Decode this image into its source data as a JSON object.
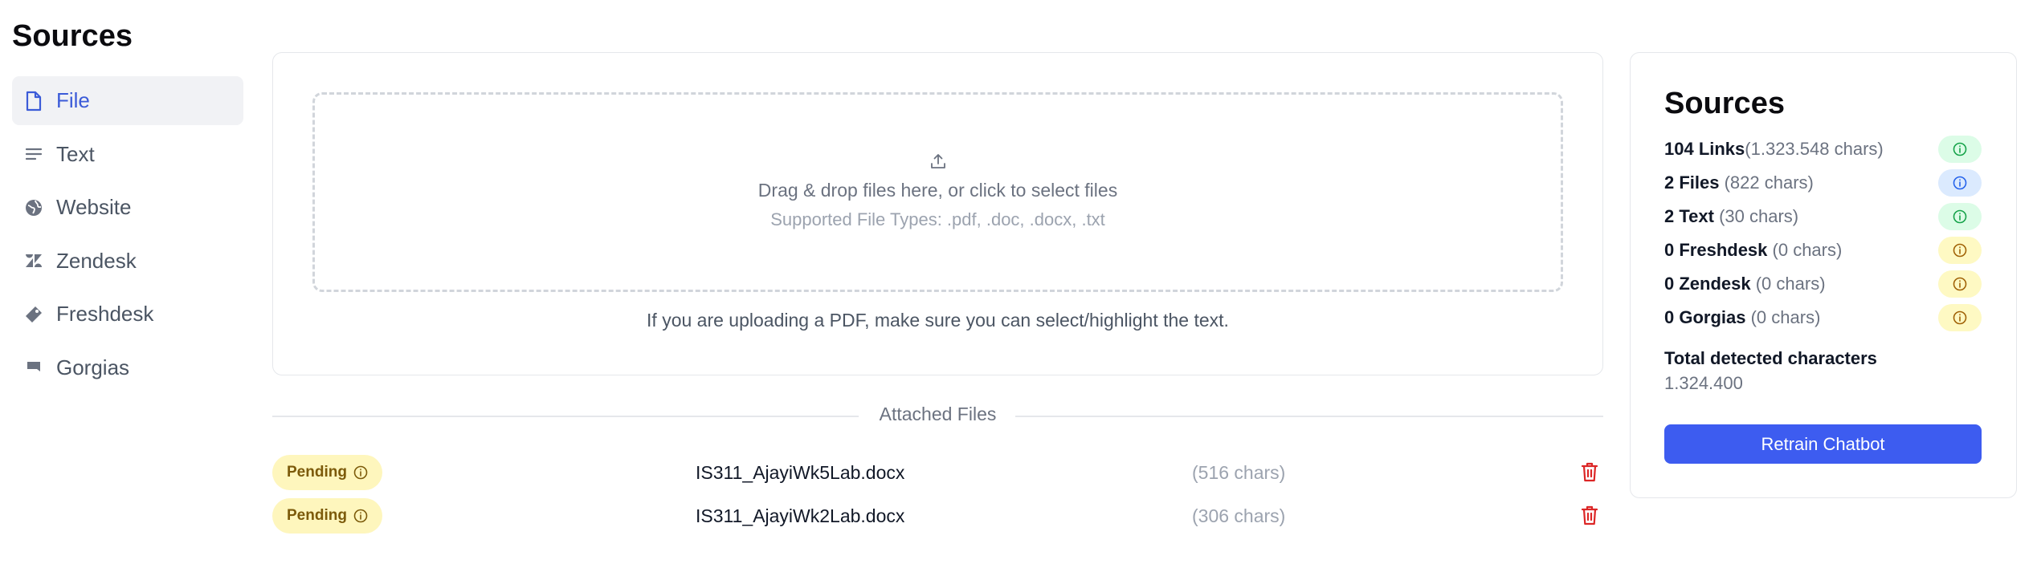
{
  "page": {
    "title": "Sources"
  },
  "nav": {
    "items": [
      {
        "label": "File",
        "icon": "file-icon",
        "active": true
      },
      {
        "label": "Text",
        "icon": "text-lines-icon",
        "active": false
      },
      {
        "label": "Website",
        "icon": "globe-icon",
        "active": false
      },
      {
        "label": "Zendesk",
        "icon": "zendesk-icon",
        "active": false
      },
      {
        "label": "Freshdesk",
        "icon": "ticket-icon",
        "active": false
      },
      {
        "label": "Gorgias",
        "icon": "gorgias-icon",
        "active": false
      }
    ]
  },
  "upload": {
    "drop_title": "Drag & drop files here, or click to select files",
    "drop_subtitle": "Supported File Types: .pdf, .doc, .docx, .txt",
    "pdf_note": "If you are uploading a PDF, make sure you can select/highlight the text."
  },
  "attached": {
    "heading": "Attached Files",
    "files": [
      {
        "status": "Pending",
        "name": "IS311_AjayiWk5Lab.docx",
        "chars": "(516 chars)"
      },
      {
        "status": "Pending",
        "name": "IS311_AjayiWk2Lab.docx",
        "chars": "(306 chars)"
      }
    ]
  },
  "summary": {
    "title": "Sources",
    "rows": [
      {
        "count": "104 Links",
        "chars": "(1.323.548 chars)",
        "pill_color": "#dcfce7",
        "icon_color": "#16a34a"
      },
      {
        "count": "2 Files",
        "chars": " (822 chars)",
        "pill_color": "#dbeafe",
        "icon_color": "#2563eb"
      },
      {
        "count": "2 Text",
        "chars": " (30 chars)",
        "pill_color": "#dcfce7",
        "icon_color": "#16a34a"
      },
      {
        "count": "0 Freshdesk",
        "chars": " (0 chars)",
        "pill_color": "#fef9c3",
        "icon_color": "#a16207"
      },
      {
        "count": "0 Zendesk",
        "chars": " (0 chars)",
        "pill_color": "#fef9c3",
        "icon_color": "#a16207"
      },
      {
        "count": "0 Gorgias",
        "chars": " (0 chars)",
        "pill_color": "#fef9c3",
        "icon_color": "#a16207"
      }
    ],
    "total_label": "Total detected characters",
    "total_value": "1.324.400",
    "retrain_label": "Retrain Chatbot"
  },
  "colors": {
    "accent": "#3d5cf0",
    "active_nav_text": "#3b5bd8",
    "delete": "#dc2626"
  }
}
